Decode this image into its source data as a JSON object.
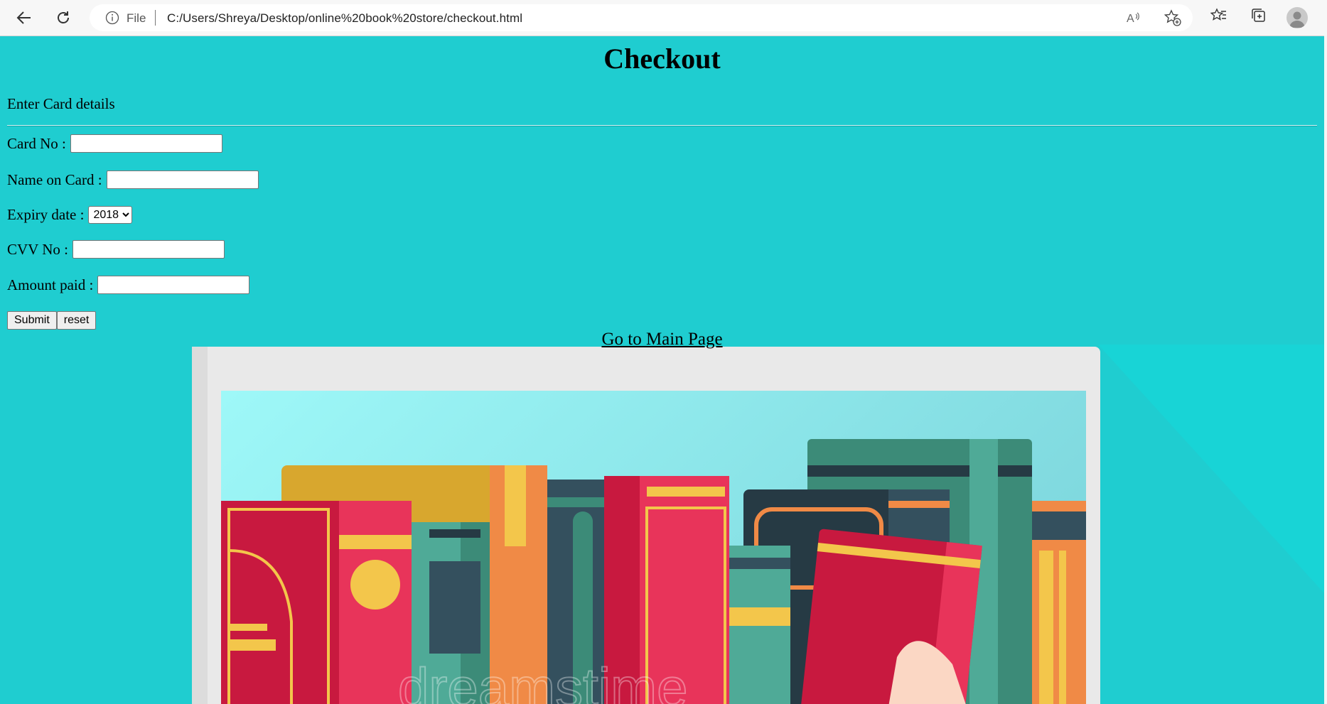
{
  "browser": {
    "file_label": "File",
    "url": "C:/Users/Shreya/Desktop/online%20book%20store/checkout.html"
  },
  "page": {
    "title": "Checkout",
    "subtitle": "Enter Card details",
    "fields": {
      "card_no_label": "Card No :",
      "card_no_value": "",
      "name_label": "Name on Card :",
      "name_value": "",
      "expiry_label": "Expiry date :",
      "expiry_selected": "2018",
      "cvv_label": "CVV No :",
      "cvv_value": "",
      "amount_label": "Amount paid :",
      "amount_value": ""
    },
    "buttons": {
      "submit": "Submit",
      "reset": "reset"
    },
    "main_link": "Go to Main Page"
  },
  "illustration": {
    "watermark": "dreamstime"
  },
  "colors": {
    "background": "#1fcdd0",
    "book_red": "#c8193f",
    "book_teal": "#3c9e8c",
    "book_orange": "#f08a46",
    "book_yellow": "#f3c64b"
  }
}
